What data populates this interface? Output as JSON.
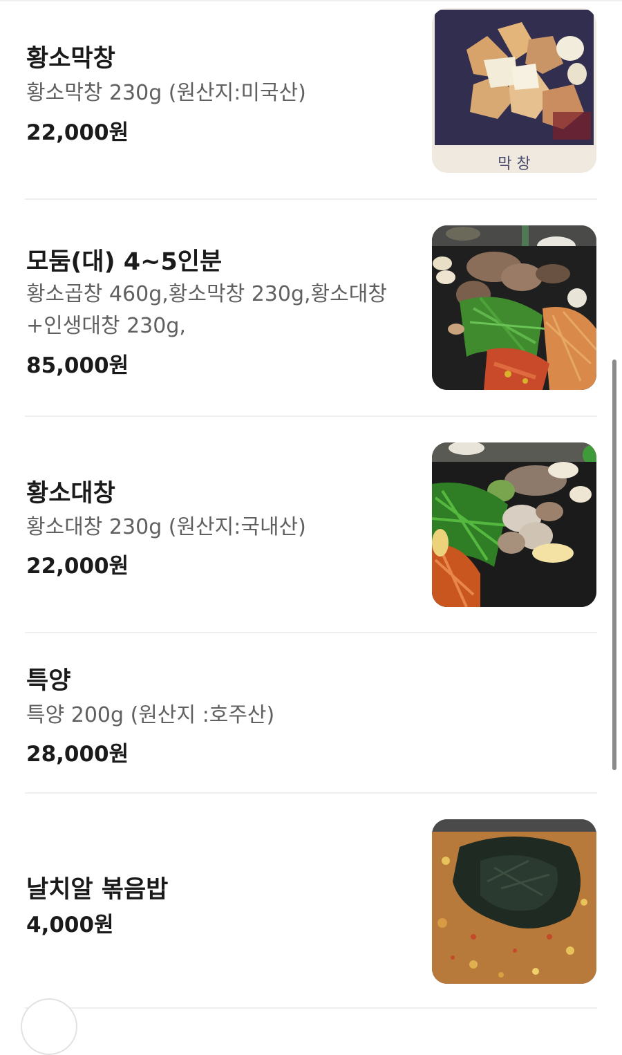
{
  "menu": {
    "items": [
      {
        "name": "황소막창",
        "desc": "황소막창 230g (원산지:미국산)",
        "price": "22,000원",
        "image_label": "막 창"
      },
      {
        "name": "모둠(대) 4~5인분",
        "desc": "황소곱창 460g,황소막창 230g,황소대창 +인생대창 230g,",
        "price": "85,000원"
      },
      {
        "name": "황소대창",
        "desc": "황소대창 230g (원산지:국내산)",
        "price": "22,000원"
      },
      {
        "name": "특양",
        "desc": "특양 200g (원산지 :호주산)",
        "price": "28,000원"
      },
      {
        "name": "날치알 볶음밥",
        "price": "4,000원"
      }
    ]
  }
}
